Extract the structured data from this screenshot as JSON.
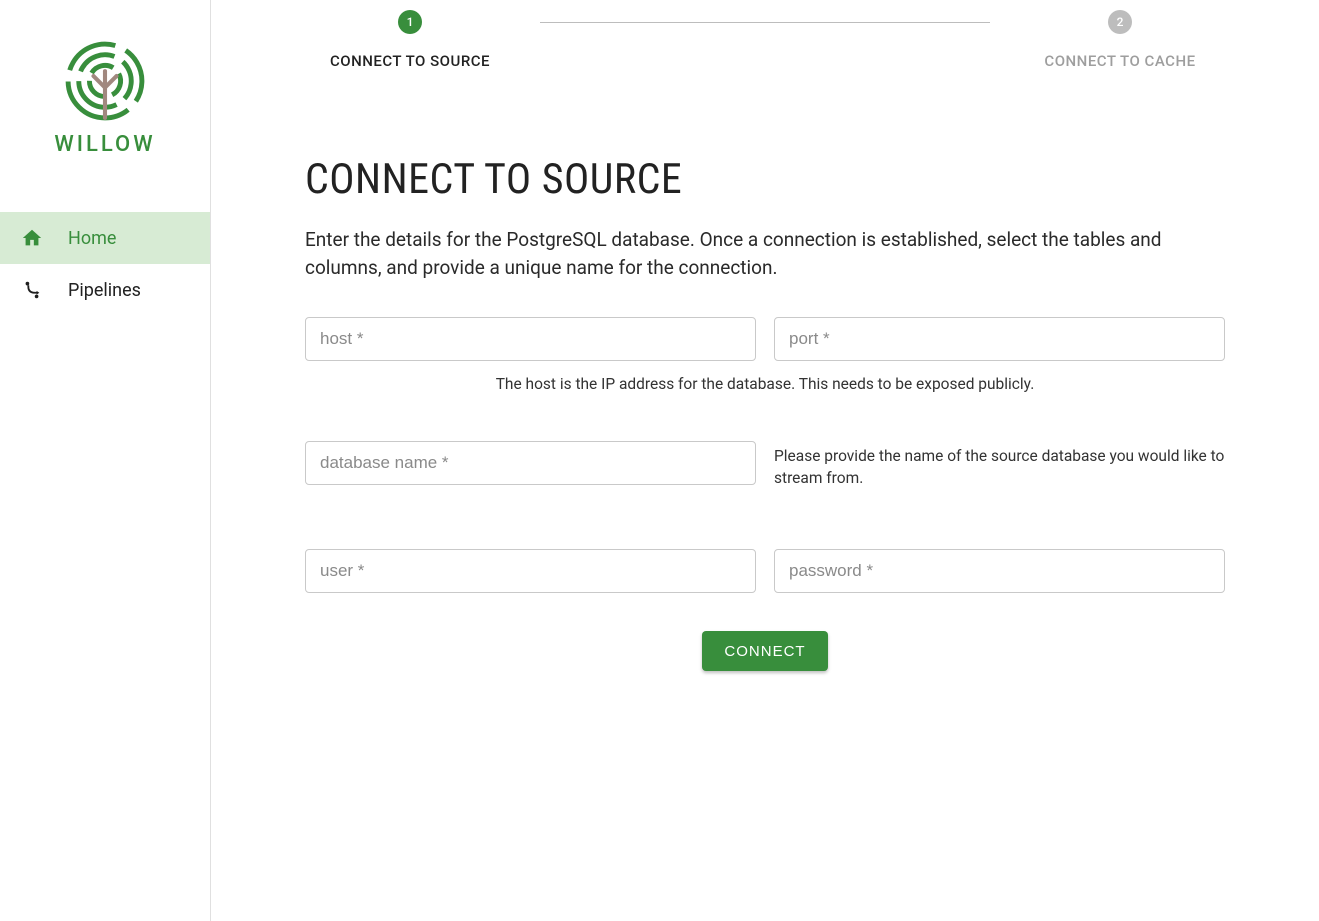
{
  "brand": {
    "name": "WILLOW"
  },
  "sidebar": {
    "items": [
      {
        "label": "Home",
        "icon": "home-icon",
        "active": true
      },
      {
        "label": "Pipelines",
        "icon": "pipelines-icon",
        "active": false
      }
    ]
  },
  "stepper": {
    "steps": [
      {
        "num": "1",
        "label": "CONNECT TO SOURCE",
        "state": "active"
      },
      {
        "num": "2",
        "label": "CONNECT TO CACHE",
        "state": "inactive"
      }
    ]
  },
  "page": {
    "title": "CONNECT TO SOURCE",
    "subtitle": "Enter the details for the PostgreSQL database. Once a connection is established, select the tables and columns, and provide a unique name for the connection."
  },
  "form": {
    "host": {
      "placeholder": "host *"
    },
    "port": {
      "placeholder": "port *"
    },
    "host_hint": "The host is the IP address for the database. This needs to be exposed publicly.",
    "dbname": {
      "placeholder": "database name *"
    },
    "dbname_note": "Please provide the name of the source database you would like to stream from.",
    "user": {
      "placeholder": "user *"
    },
    "password": {
      "placeholder": "password *"
    },
    "connect_label": "CONNECT"
  }
}
